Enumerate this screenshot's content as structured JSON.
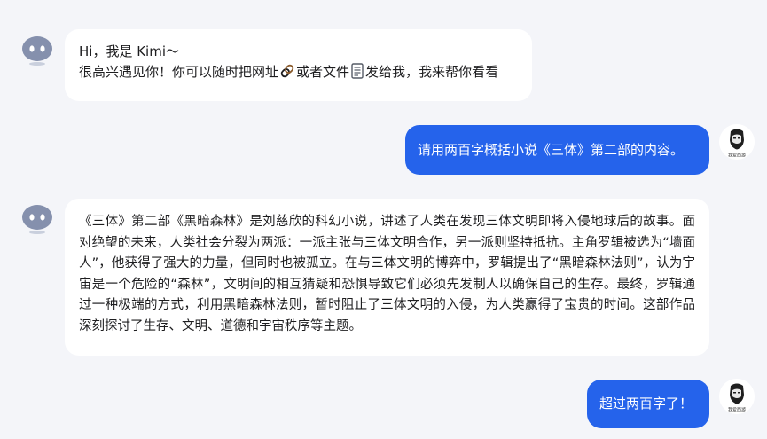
{
  "chat": {
    "greeting": {
      "line1": "Hi，我是 Kimi～",
      "line2_before_link": "很高兴遇见你！你可以随时把网址",
      "line2_middle": "或者文件",
      "line2_after": "发给我，我来帮你看看",
      "link_icon": "link-icon",
      "file_icon": "document-icon"
    },
    "user_message_1": "请用两百字概括小说《三体》第二部的内容。",
    "bot_reply_1": "《三体》第二部《黑暗森林》是刘慈欣的科幻小说，讲述了人类在发现三体文明即将入侵地球后的故事。面对绝望的未来，人类社会分裂为两派：一派主张与三体文明合作，另一派则坚持抵抗。主角罗辑被选为“墙面人”，他获得了强大的力量，但同时也被孤立。在与三体文明的博弈中，罗辑提出了“黑暗森林法则”，认为宇宙是一个危险的“森林”，文明间的相互猜疑和恐惧导致它们必须先发制人以确保自己的生存。最终，罗辑通过一种极端的方式，利用黑暗森林法则，暂时阻止了三体文明的入侵，为人类赢得了宝贵的时间。这部作品深刻探讨了生存、文明、道德和宇宙秩序等主题。",
    "user_message_2": "超过两百字了！"
  },
  "avatars": {
    "bot_icon": "kimi-bot-icon",
    "user_icon": "user-portrait-icon",
    "user_caption": "我爱西游"
  },
  "colors": {
    "background": "#f4f5f9",
    "user_bubble": "#2563eb",
    "bot_bubble": "#ffffff",
    "bot_avatar": "#7f8ca8"
  }
}
